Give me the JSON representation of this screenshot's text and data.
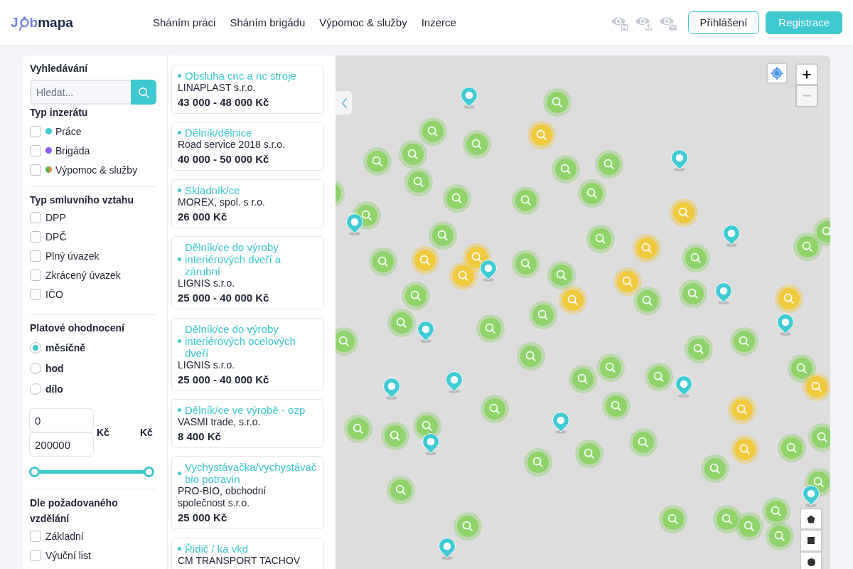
{
  "header": {
    "logo": {
      "text_before_pin": "J",
      "text_after_pin": "b",
      "text_dark": "mapa"
    },
    "nav": [
      "Sháním práci",
      "Sháním brigádu",
      "Výpomoc & služby",
      "Inzerce"
    ],
    "login_button": "Přihlášení",
    "register_button": "Registrace"
  },
  "filters": {
    "search": {
      "heading": "Vyhledávání",
      "placeholder": "Hledat..."
    },
    "listing_type": {
      "heading": "Typ inzerátu",
      "options": [
        {
          "label": "Práce",
          "checked": false,
          "dot": [
            {
              "color": "#3ec8cf"
            }
          ]
        },
        {
          "label": "Brigáda",
          "checked": false,
          "dot": [
            {
              "color": "#8b5cf6"
            }
          ]
        },
        {
          "label": "Výpomoc & služby",
          "checked": false,
          "dot": [
            {
              "color": "#4cbb4c"
            },
            {
              "color": "#f5883a"
            }
          ]
        }
      ]
    },
    "contract_type": {
      "heading": "Typ smluvního vztahu",
      "options": [
        {
          "label": "DPP",
          "checked": false
        },
        {
          "label": "DPČ",
          "checked": false
        },
        {
          "label": "Plný úvazek",
          "checked": false
        },
        {
          "label": "Zkrácený úvazek",
          "checked": false
        },
        {
          "label": "IČO",
          "checked": false
        }
      ]
    },
    "salary": {
      "heading": "Platové ohodnocení",
      "periods": [
        {
          "label": "měsíčně",
          "selected": true
        },
        {
          "label": "hod",
          "selected": false
        },
        {
          "label": "dílo",
          "selected": false
        }
      ],
      "min_value": "0",
      "max_value": "200000",
      "currency_labels": [
        "Kč",
        "Kč"
      ],
      "range_handles": [
        {
          "level": 0
        },
        {
          "level": 1
        }
      ]
    },
    "education": {
      "heading": "Dle požadovaného vzdělání",
      "options": [
        {
          "label": "Základní",
          "checked": false
        },
        {
          "label": "Výuční list",
          "checked": false
        }
      ]
    }
  },
  "listings": [
    {
      "title": "Obsluha cnc a nc stroje",
      "company": "LINAPLAST s.r.o.",
      "salary": "43 000 - 48 000 Kč"
    },
    {
      "title": "Dělník/dělnice",
      "company": "Road service 2018 s.r.o.",
      "salary": "40 000 - 50 000 Kč"
    },
    {
      "title": "Skladník/ce",
      "company": "MOREX, spol. s r.o.",
      "salary": "26 000 Kč"
    },
    {
      "title": "Dělník/ce do výroby interiérových dveří a zárubní",
      "company": "LIGNIS s.r.o.",
      "salary": "25 000 - 40 000 Kč"
    },
    {
      "title": "Dělník/ce do výroby interiérových ocelových dveří",
      "company": "LIGNIS s.r.o.",
      "salary": "25 000 - 40 000 Kč"
    },
    {
      "title": "Dělník/ce ve výrobě - ozp",
      "company": "VASMI trade, s.r.o.",
      "salary": "8 400 Kč"
    },
    {
      "title": "Vychystávačka/vychystávač bio potravin",
      "company": "PRO-BIO, obchodní společnost s.r.o.",
      "salary": "25 000 Kč"
    },
    {
      "title": "Řidič / ka vkd",
      "company": "CM TRANSPORT TACHOV"
    }
  ],
  "map": {
    "zoom_in_disabled": false,
    "zoom_out_disabled": true,
    "markers": [
      {
        "kind": "cluster",
        "color": "#8fd36a"
      },
      {
        "kind": "cluster",
        "color": "#8fd36a"
      },
      {
        "kind": "cluster",
        "color": "#f0c93f"
      },
      {
        "kind": "cluster",
        "color": "#8fd36a"
      },
      {
        "kind": "cluster",
        "color": "#8fd36a"
      },
      {
        "kind": "cluster",
        "color": "#8fd36a"
      },
      {
        "kind": "cluster",
        "color": "#8fd36a"
      },
      {
        "kind": "cluster",
        "color": "#8fd36a"
      },
      {
        "kind": "cluster",
        "color": "#8fd36a"
      },
      {
        "kind": "cluster",
        "color": "#8fd36a"
      },
      {
        "kind": "cluster",
        "color": "#8fd36a"
      },
      {
        "kind": "cluster",
        "color": "#8fd36a"
      },
      {
        "kind": "cluster",
        "color": "#8fd36a"
      },
      {
        "kind": "cluster",
        "color": "#8fd36a"
      },
      {
        "kind": "cluster",
        "color": "#f0c93f"
      },
      {
        "kind": "cluster",
        "color": "#8fd36a"
      },
      {
        "kind": "cluster",
        "color": "#8fd36a"
      },
      {
        "kind": "cluster",
        "color": "#f0c93f"
      },
      {
        "kind": "cluster",
        "color": "#8fd36a"
      },
      {
        "kind": "cluster",
        "color": "#8fd36a"
      },
      {
        "kind": "cluster",
        "color": "#8fd36a"
      },
      {
        "kind": "cluster",
        "color": "#f0c93f"
      },
      {
        "kind": "cluster",
        "color": "#f0c93f"
      },
      {
        "kind": "cluster",
        "color": "#f0c93f"
      },
      {
        "kind": "cluster",
        "color": "#8fd36a"
      },
      {
        "kind": "cluster",
        "color": "#8fd36a"
      },
      {
        "kind": "cluster",
        "color": "#8fd36a"
      },
      {
        "kind": "cluster",
        "color": "#f0c93f"
      },
      {
        "kind": "cluster",
        "color": "#f0c93f"
      },
      {
        "kind": "cluster",
        "color": "#8fd36a"
      },
      {
        "kind": "cluster",
        "color": "#8fd36a"
      },
      {
        "kind": "cluster",
        "color": "#f0c93f"
      },
      {
        "kind": "cluster",
        "color": "#8fd36a"
      },
      {
        "kind": "cluster",
        "color": "#8fd36a"
      },
      {
        "kind": "cluster",
        "color": "#8fd36a"
      },
      {
        "kind": "cluster",
        "color": "#8fd36a"
      },
      {
        "kind": "cluster",
        "color": "#8fd36a"
      },
      {
        "kind": "cluster",
        "color": "#8fd36a"
      },
      {
        "kind": "cluster",
        "color": "#8fd36a"
      },
      {
        "kind": "cluster",
        "color": "#8fd36a"
      },
      {
        "kind": "cluster",
        "color": "#8fd36a"
      },
      {
        "kind": "cluster",
        "color": "#8fd36a"
      },
      {
        "kind": "cluster",
        "color": "#8fd36a"
      },
      {
        "kind": "cluster",
        "color": "#8fd36a"
      },
      {
        "kind": "cluster",
        "color": "#f0c93f"
      },
      {
        "kind": "cluster",
        "color": "#8fd36a"
      },
      {
        "kind": "cluster",
        "color": "#8fd36a"
      },
      {
        "kind": "cluster",
        "color": "#f0c93f"
      },
      {
        "kind": "cluster",
        "color": "#8fd36a"
      },
      {
        "kind": "cluster",
        "color": "#8fd36a"
      },
      {
        "kind": "cluster",
        "color": "#8fd36a"
      },
      {
        "kind": "cluster",
        "color": "#8fd36a"
      },
      {
        "kind": "cluster",
        "color": "#8fd36a"
      },
      {
        "kind": "cluster",
        "color": "#8fd36a"
      },
      {
        "kind": "cluster",
        "color": "#f0c93f"
      },
      {
        "kind": "cluster",
        "color": "#8fd36a"
      },
      {
        "kind": "cluster",
        "color": "#8fd36a"
      },
      {
        "kind": "cluster",
        "color": "#8fd36a"
      },
      {
        "kind": "cluster",
        "color": "#8fd36a"
      },
      {
        "kind": "cluster",
        "color": "#8fd36a"
      },
      {
        "kind": "cluster",
        "color": "#8fd36a"
      },
      {
        "kind": "cluster",
        "color": "#8fd36a"
      },
      {
        "kind": "cluster",
        "color": "#8fd36a"
      },
      {
        "kind": "cluster",
        "color": "#8fd36a"
      },
      {
        "kind": "cluster",
        "color": "#8fd36a"
      },
      {
        "kind": "cluster",
        "color": "#8fd36a"
      },
      {
        "kind": "pin",
        "color": "#3ecbd4"
      },
      {
        "kind": "pin",
        "color": "#3ecbd4"
      },
      {
        "kind": "pin",
        "color": "#3ecbd4"
      },
      {
        "kind": "pin",
        "color": "#3ecbd4"
      },
      {
        "kind": "pin",
        "color": "#3ecbd4"
      },
      {
        "kind": "pin",
        "color": "#3ecbd4"
      },
      {
        "kind": "pin",
        "color": "#3ecbd4"
      },
      {
        "kind": "pin",
        "color": "#3ecbd4"
      },
      {
        "kind": "pin",
        "color": "#3ecbd4"
      },
      {
        "kind": "pin",
        "color": "#3ecbd4"
      },
      {
        "kind": "pin",
        "color": "#3ecbd4"
      },
      {
        "kind": "pin",
        "color": "#3ecbd4"
      },
      {
        "kind": "pin",
        "color": "#3ecbd4"
      },
      {
        "kind": "pin",
        "color": "#3ecbd4"
      },
      {
        "kind": "pin",
        "color": "#3ecbd4"
      }
    ]
  }
}
